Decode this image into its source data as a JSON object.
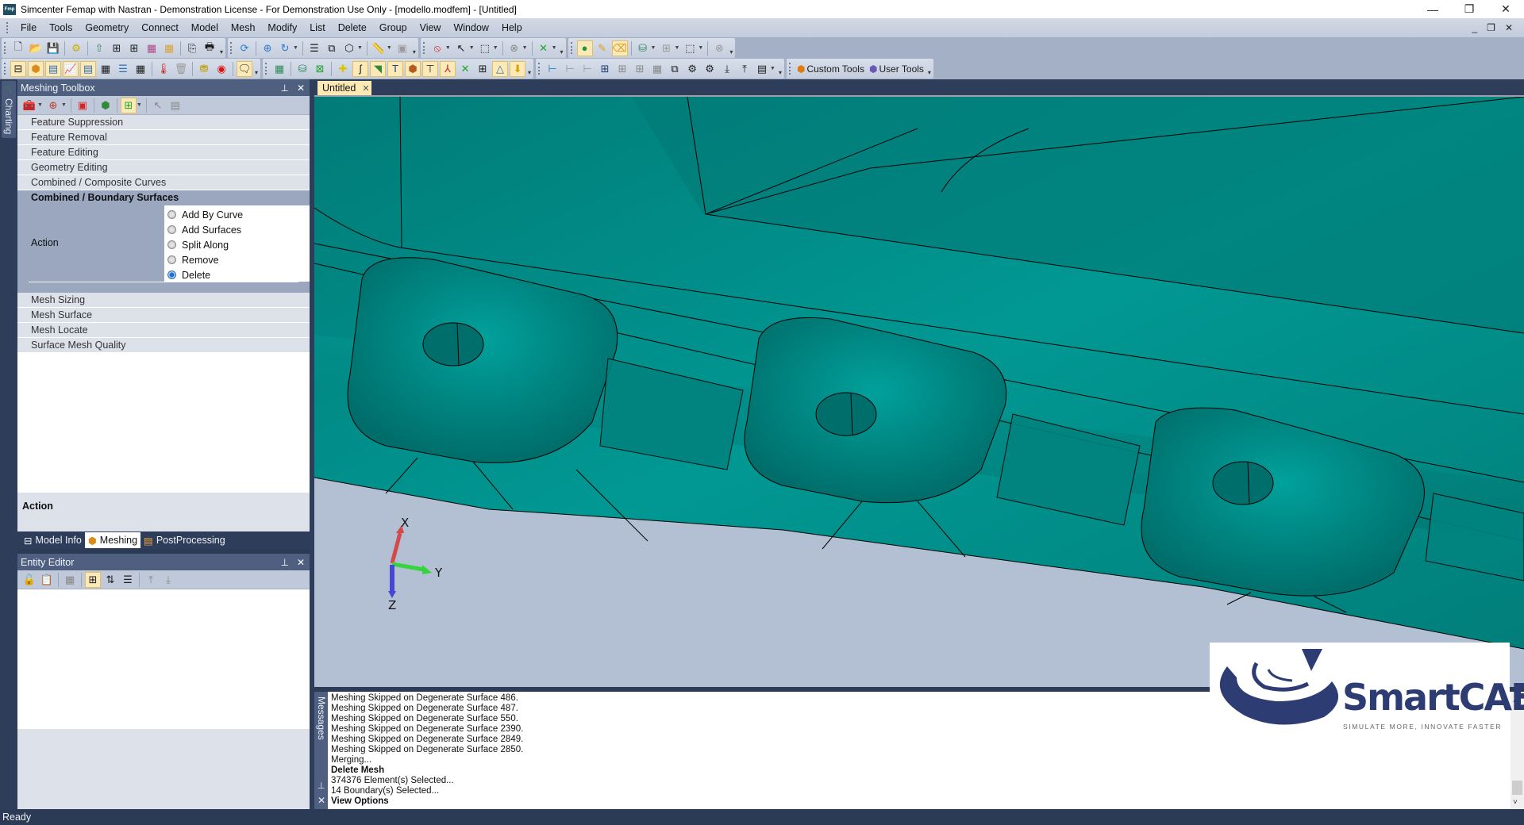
{
  "window": {
    "title": "Simcenter Femap with Nastran - Demonstration License - For Demonstration Use Only - [modello.modfem] - [Untitled]",
    "app_icon_text": "Fmp",
    "minimize": "—",
    "restore": "❐",
    "close": "✕"
  },
  "menu": {
    "items": [
      "File",
      "Tools",
      "Geometry",
      "Connect",
      "Model",
      "Mesh",
      "Modify",
      "List",
      "Delete",
      "Group",
      "View",
      "Window",
      "Help"
    ],
    "mdi_minimize": "_",
    "mdi_restore": "❐",
    "mdi_close": "✕"
  },
  "toolbars": {
    "custom_tools": "Custom Tools",
    "user_tools": "User Tools"
  },
  "left_strip": {
    "charting_tab": "Charting"
  },
  "meshing_toolbox": {
    "title": "Meshing Toolbox",
    "pin": "📌",
    "close": "✕",
    "sections_top": [
      "Feature Suppression",
      "Feature Removal",
      "Feature Editing",
      "Geometry Editing",
      "Combined / Composite Curves"
    ],
    "active_section": "Combined / Boundary Surfaces",
    "action_label": "Action",
    "action_options": [
      {
        "label": "Add By Curve",
        "selected": false
      },
      {
        "label": "Add Surfaces",
        "selected": false
      },
      {
        "label": "Split Along",
        "selected": false
      },
      {
        "label": "Remove",
        "selected": false
      },
      {
        "label": "Delete",
        "selected": true
      }
    ],
    "sections_bottom": [
      "Mesh Sizing",
      "Mesh Surface",
      "Mesh Locate",
      "Surface Mesh Quality"
    ],
    "help_title": "Action"
  },
  "panel_tabs": [
    {
      "label": "Model Info",
      "active": false
    },
    {
      "label": "Meshing",
      "active": true
    },
    {
      "label": "PostProcessing",
      "active": false
    }
  ],
  "entity_editor": {
    "title": "Entity Editor"
  },
  "document": {
    "tab_label": "Untitled",
    "tab_close": "✕"
  },
  "viewport": {
    "model_color": "#008b87",
    "background_color": "#b3bfd2",
    "triad": {
      "x": "X",
      "y": "Y",
      "z": "Z"
    }
  },
  "logo": {
    "name": "SmartCAE",
    "tagline": "SIMULATE MORE, INNOVATE FASTER"
  },
  "messages": {
    "panel_label": "Messages",
    "lines": [
      {
        "text": "Meshing Skipped on Degenerate Surface 486.",
        "bold": false
      },
      {
        "text": "Meshing Skipped on Degenerate Surface 487.",
        "bold": false
      },
      {
        "text": "Meshing Skipped on Degenerate Surface 550.",
        "bold": false
      },
      {
        "text": "Meshing Skipped on Degenerate Surface 2390.",
        "bold": false
      },
      {
        "text": "Meshing Skipped on Degenerate Surface 2849.",
        "bold": false
      },
      {
        "text": "Meshing Skipped on Degenerate Surface 2850.",
        "bold": false
      },
      {
        "text": "Merging...",
        "bold": false
      },
      {
        "text": "Delete Mesh",
        "bold": true
      },
      {
        "text": "374376 Element(s) Selected...",
        "bold": false
      },
      {
        "text": "14 Boundary(s) Selected...",
        "bold": false
      },
      {
        "text": "View Options",
        "bold": true
      }
    ]
  },
  "status": {
    "text": "Ready"
  }
}
